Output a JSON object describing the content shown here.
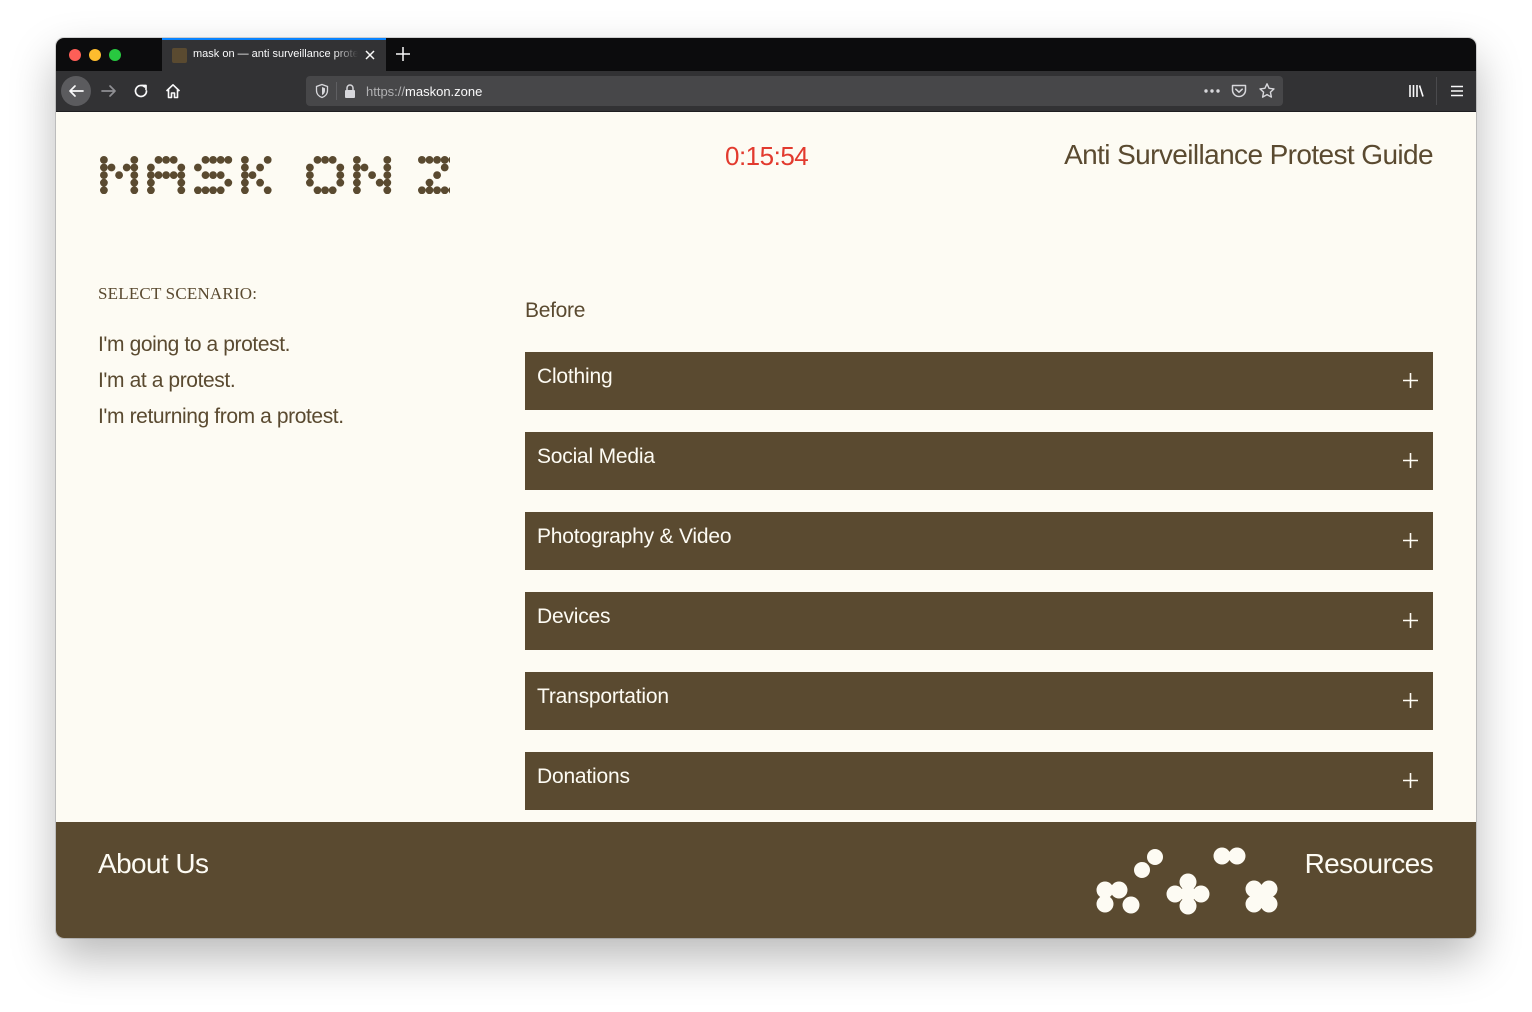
{
  "browser": {
    "tab_title": "mask on — anti surveillance protest guide",
    "url_scheme": "https://",
    "url_host": "maskon.zone"
  },
  "header": {
    "logo_text": "MASK ON ZONE",
    "timer": "0:15:54",
    "subtitle": "Anti Surveillance Protest Guide"
  },
  "sidebar": {
    "heading": "SELECT SCENARIO:",
    "scenarios": [
      "I'm going to a protest.",
      "I'm at a protest.",
      "I'm returning from a protest."
    ]
  },
  "main": {
    "section_label": "Before",
    "items": [
      {
        "label": "Clothing"
      },
      {
        "label": "Social Media"
      },
      {
        "label": "Photography & Video"
      },
      {
        "label": "Devices"
      },
      {
        "label": "Transportation"
      },
      {
        "label": "Donations"
      }
    ],
    "expand_icon": "plus-icon"
  },
  "footer": {
    "about_label": "About Us",
    "resources_label": "Resources"
  },
  "colors": {
    "brand_brown": "#5a4a30",
    "page_background": "#fdfbf3",
    "timer_red": "#e23a2e",
    "browser_chrome": "#323234"
  }
}
